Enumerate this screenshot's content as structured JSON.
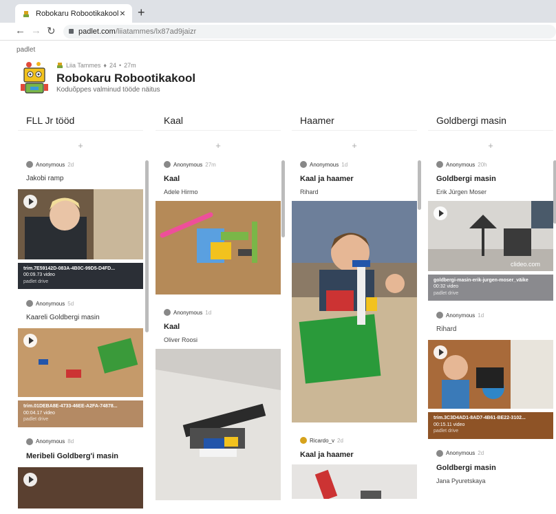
{
  "browser": {
    "tab_title": "Robokaru Robootikakool",
    "url_host": "padlet.com",
    "url_path": "/liiatammes/lx87ad9jaizr"
  },
  "board": {
    "brand": "padlet",
    "author": "Liia Tammes",
    "likes": "24",
    "age": "27m",
    "title": "Robokaru Robootikakool",
    "subtitle": "Koduõppes valminud tööde näitus",
    "add_symbol": "+"
  },
  "columns": [
    {
      "title": "FLL Jr tööd",
      "posts": [
        {
          "author": "Anonymous",
          "time": "2d",
          "title": "Jakobi ramp",
          "body": "",
          "file": "trim.7E59142D-083A-4B0C-99D5-D4FD...",
          "duration": "00:09.73 video",
          "source": "padlet drive"
        },
        {
          "author": "Anonymous",
          "time": "5d",
          "title": "Kaareli Goldbergi masin",
          "body": "",
          "file": "trim.01DEBA8E-4733-46EE-A2FA-74878...",
          "duration": "00:04.17 video",
          "source": "padlet drive"
        },
        {
          "author": "Anonymous",
          "time": "8d",
          "title": "Meribeli Goldberg'i masin",
          "body": ""
        }
      ]
    },
    {
      "title": "Kaal",
      "posts": [
        {
          "author": "Anonymous",
          "time": "27m",
          "title": "Kaal",
          "body": "Adele Hirmo"
        },
        {
          "author": "Anonymous",
          "time": "1d",
          "title": "Kaal",
          "body": "Oliver Roosi"
        }
      ]
    },
    {
      "title": "Haamer",
      "posts": [
        {
          "author": "Anonymous",
          "time": "1d",
          "title": "Kaal ja haamer",
          "body": "Rihard"
        },
        {
          "author": "Ricardo_v",
          "time": "2d",
          "title": "Kaal ja haamer",
          "body": ""
        }
      ]
    },
    {
      "title": "Goldbergi masin",
      "posts": [
        {
          "author": "Anonymous",
          "time": "20h",
          "title": "Goldbergi masin",
          "body": "Erik Jürgen Moser",
          "file": "goldbergi-masin-erik-jurgen-moser_väike",
          "duration": "00:32 video",
          "source": "padlet drive",
          "watermark": "clideo.com"
        },
        {
          "author": "Anonymous",
          "time": "1d",
          "title": "",
          "body": "Rihard",
          "file": "trim.3C3D4AD1-8AD7-4B61-BE22-3102...",
          "duration": "00:15.11 video",
          "source": "padlet drive"
        },
        {
          "author": "Anonymous",
          "time": "2d",
          "title": "Goldbergi masin",
          "body": "Jana Pyuretskaya"
        }
      ]
    }
  ]
}
